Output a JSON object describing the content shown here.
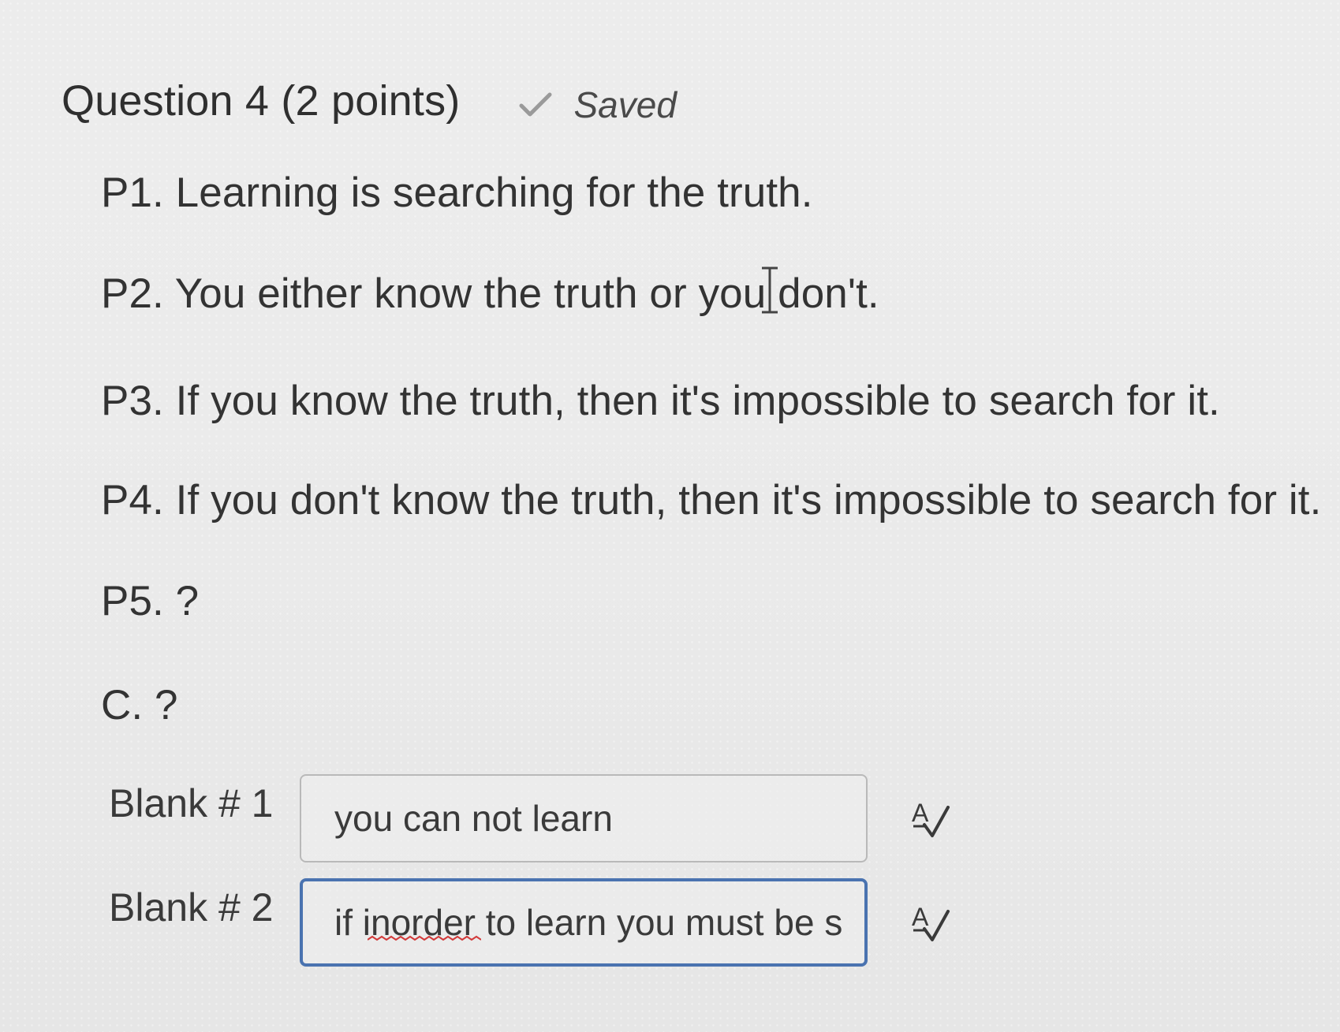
{
  "question": {
    "title": "Question 4 (2 points)",
    "status": "Saved",
    "status_icon": "check-icon"
  },
  "premises": [
    "P1. Learning is searching for the truth.",
    "P2. You either know the truth or you don't.",
    "P3. If you know the truth, then it's impossible to search for it.",
    "P4. If you don't know the truth, then it's impossible to search for it.",
    "P5. ?",
    "C. ?"
  ],
  "blanks": [
    {
      "label": "Blank # 1",
      "value": "you can not learn",
      "focused": false,
      "spellcheck_icon": "spellcheck-icon"
    },
    {
      "label": "Blank # 2",
      "value": "if inorder to learn you must be s",
      "focused": true,
      "spellcheck_icon": "spellcheck-icon"
    }
  ],
  "colors": {
    "focus_border": "#4a73b0",
    "spell_error": "#d23a3a"
  }
}
